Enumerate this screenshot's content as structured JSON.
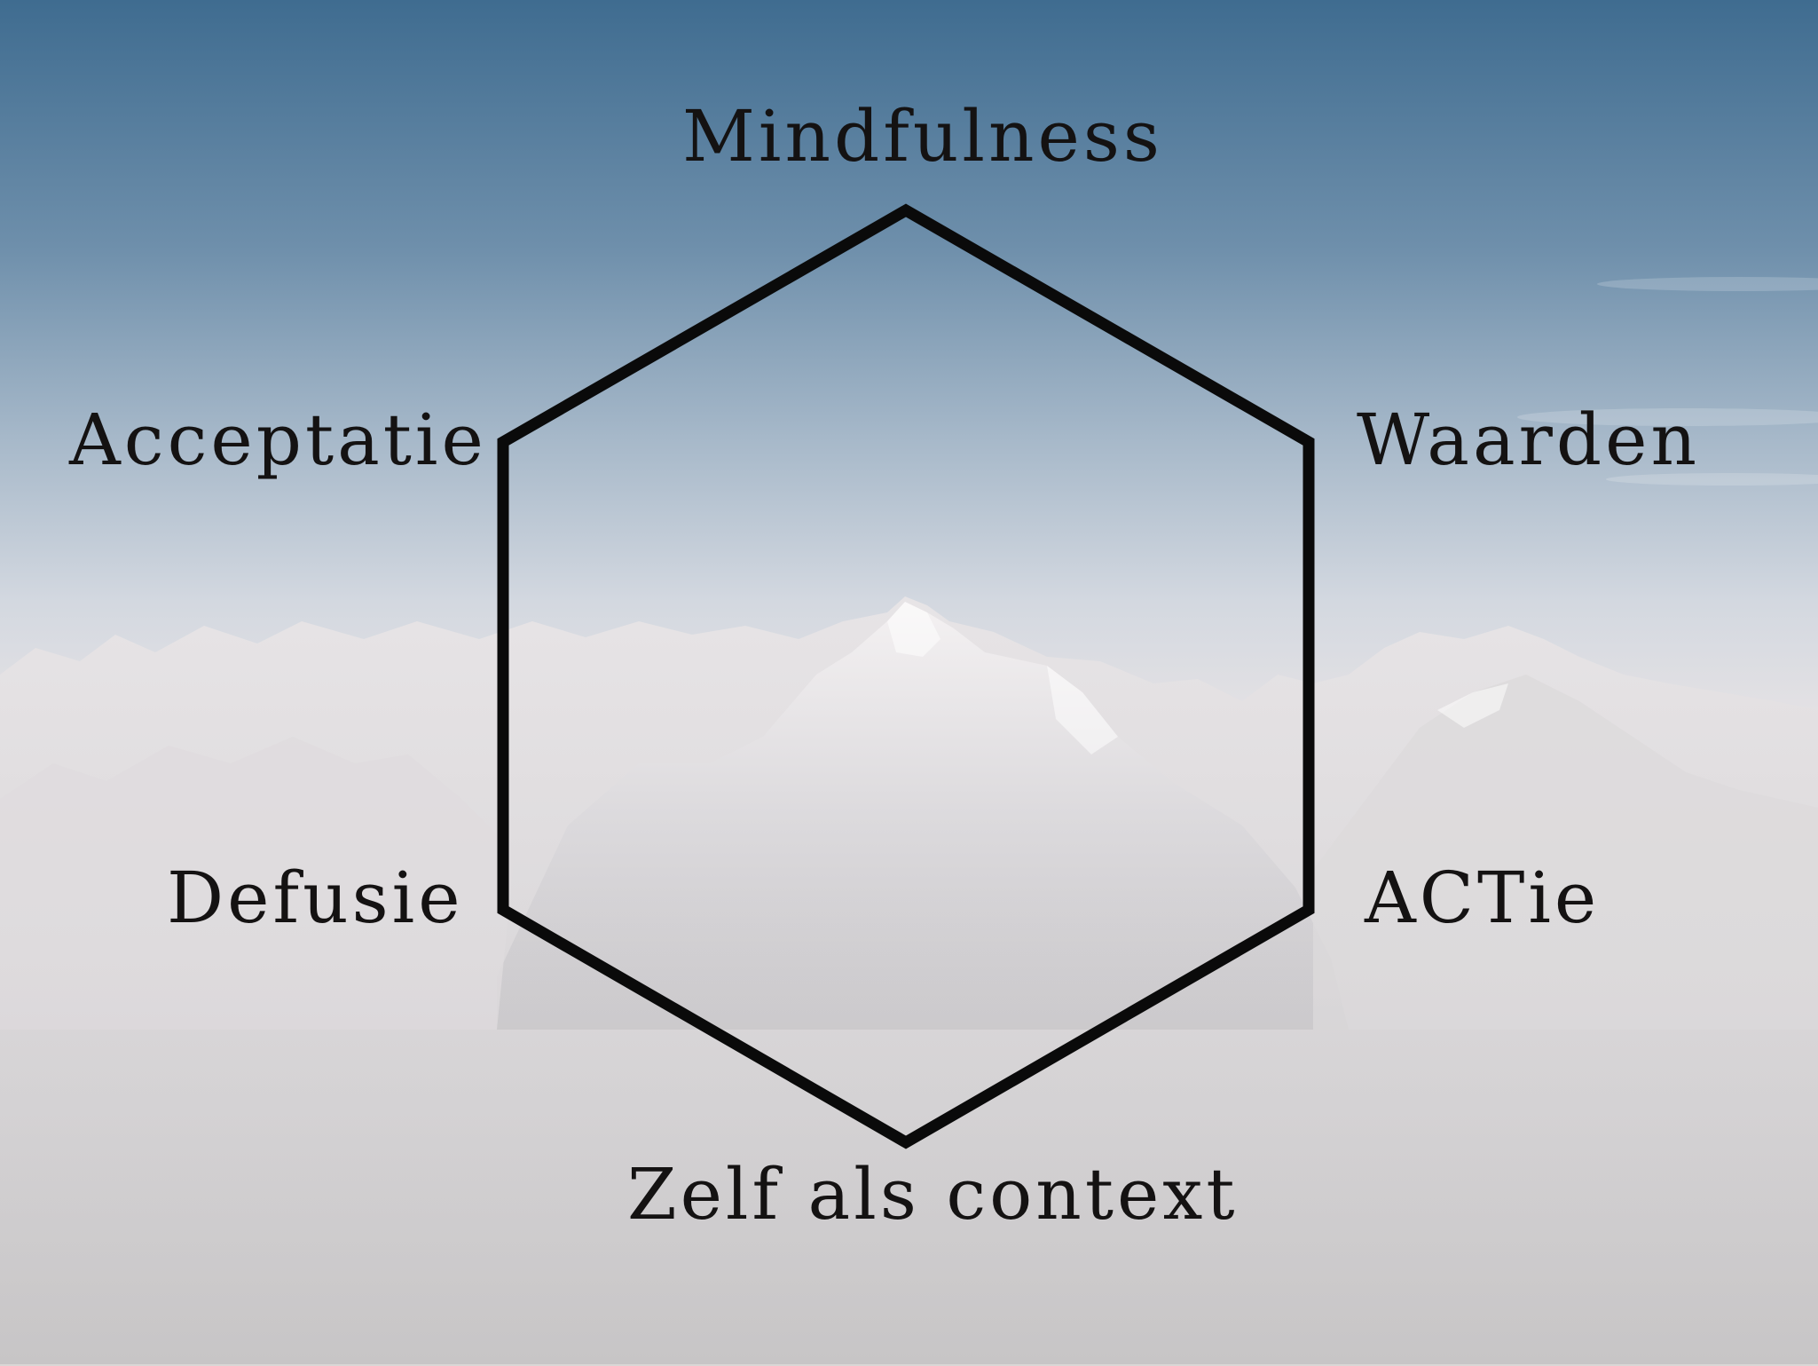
{
  "diagram": {
    "nodes": [
      {
        "key": "top",
        "label": "Mindfulness"
      },
      {
        "key": "upper-left",
        "label": "Acceptatie"
      },
      {
        "key": "upper-right",
        "label": "Waarden"
      },
      {
        "key": "lower-left",
        "label": "Defusie"
      },
      {
        "key": "lower-right",
        "label": "ACTie"
      },
      {
        "key": "bottom",
        "label": "Zelf als context"
      }
    ],
    "shape": "hexagon",
    "stroke_color": "#0a0a0a"
  },
  "background": {
    "description_icon": "mountain-range-sky-photo",
    "sky_top_color": "#3f6c90",
    "sky_mid_color": "#b9c9d8",
    "haze_color": "#dcdde2",
    "mountain_color": "#e9e7e8",
    "ground_color": "#c8c6c7"
  }
}
